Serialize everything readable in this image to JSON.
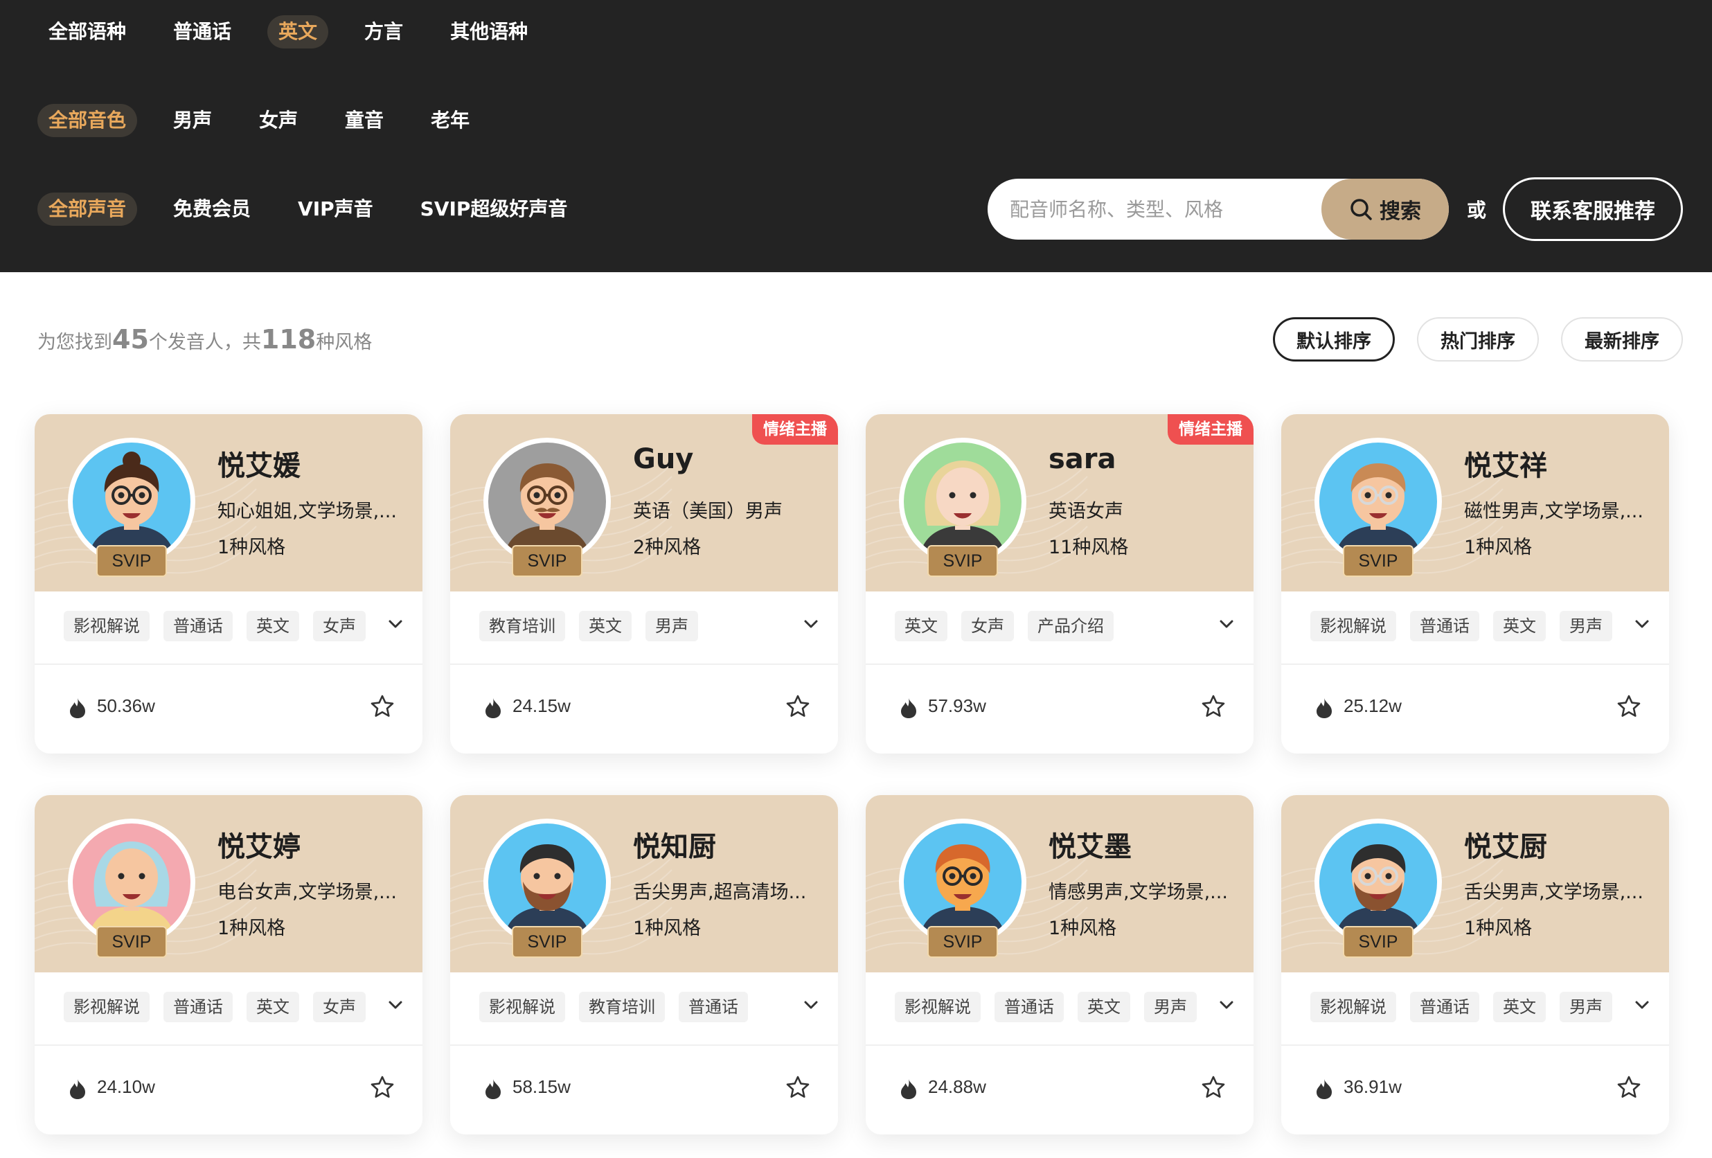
{
  "filters": {
    "language": [
      {
        "label": "全部语种",
        "active": false
      },
      {
        "label": "普通话",
        "active": false
      },
      {
        "label": "英文",
        "active": true
      },
      {
        "label": "方言",
        "active": false
      },
      {
        "label": "其他语种",
        "active": false
      }
    ],
    "timbre": [
      {
        "label": "全部音色",
        "active": true
      },
      {
        "label": "男声",
        "active": false
      },
      {
        "label": "女声",
        "active": false
      },
      {
        "label": "童音",
        "active": false
      },
      {
        "label": "老年",
        "active": false
      }
    ],
    "membership": [
      {
        "label": "全部声音",
        "active": true
      },
      {
        "label": "免费会员",
        "active": false
      },
      {
        "label": "VIP声音",
        "active": false
      },
      {
        "label": "SVIP超级好声音",
        "active": false
      }
    ]
  },
  "search": {
    "placeholder": "配音师名称、类型、风格",
    "value": "",
    "button_label": "搜索",
    "or_text": "或",
    "contact_label": "联系客服推荐"
  },
  "results": {
    "prefix": "为您找到",
    "speakers": "45",
    "middle": "个发音人，共",
    "styles": "118",
    "suffix": "种风格"
  },
  "sort": {
    "options": [
      "默认排序",
      "热门排序",
      "最新排序"
    ],
    "active": "默认排序"
  },
  "colors": {
    "header_bg": "#232323",
    "active_chip_text": "#e8a85c",
    "card_head_bg": "#e7d4bb",
    "search_btn_bg": "#c6ab88",
    "emotion_badge_bg": "#ef5050",
    "svip_badge_bg": "#b48a52"
  },
  "cards": [
    {
      "name": "悦艾媛",
      "desc": "知心姐姐,文学场景,...",
      "styles": "1种风格",
      "badge": "SVIP",
      "emotion": "",
      "tags": [
        "影视解说",
        "普通话",
        "英文",
        "女声"
      ],
      "plays": "50.36w",
      "avatar_icon": "female-glasses-bun-avatar-icon"
    },
    {
      "name": "Guy",
      "desc": "英语（美国）男声",
      "styles": "2种风格",
      "badge": "SVIP",
      "emotion": "情绪主播",
      "tags": [
        "教育培训",
        "英文",
        "男声"
      ],
      "plays": "24.15w",
      "avatar_icon": "male-mustache-avatar-icon"
    },
    {
      "name": "sara",
      "desc": "英语女声",
      "styles": "11种风格",
      "badge": "SVIP",
      "emotion": "情绪主播",
      "tags": [
        "英文",
        "女声",
        "产品介绍"
      ],
      "plays": "57.93w",
      "avatar_icon": "female-blonde-avatar-icon"
    },
    {
      "name": "悦艾祥",
      "desc": "磁性男声,文学场景,...",
      "styles": "1种风格",
      "badge": "SVIP",
      "emotion": "",
      "tags": [
        "影视解说",
        "普通话",
        "英文",
        "男声"
      ],
      "plays": "25.12w",
      "avatar_icon": "male-glasses-avatar-icon"
    },
    {
      "name": "悦艾婷",
      "desc": "电台女声,文学场景,...",
      "styles": "1种风格",
      "badge": "SVIP",
      "emotion": "",
      "tags": [
        "影视解说",
        "普通话",
        "英文",
        "女声"
      ],
      "plays": "24.10w",
      "avatar_icon": "female-pink-hair-avatar-icon"
    },
    {
      "name": "悦知厨",
      "desc": "舌尖男声,超高清场...",
      "styles": "1种风格",
      "badge": "SVIP",
      "emotion": "",
      "tags": [
        "影视解说",
        "教育培训",
        "普通话"
      ],
      "plays": "58.15w",
      "avatar_icon": "male-beard-avatar-icon"
    },
    {
      "name": "悦艾墨",
      "desc": "情感男声,文学场景,...",
      "styles": "1种风格",
      "badge": "SVIP",
      "emotion": "",
      "tags": [
        "影视解说",
        "普通话",
        "英文",
        "男声"
      ],
      "plays": "24.88w",
      "avatar_icon": "male-orange-hair-avatar-icon"
    },
    {
      "name": "悦艾厨",
      "desc": "舌尖男声,文学场景,...",
      "styles": "1种风格",
      "badge": "SVIP",
      "emotion": "",
      "tags": [
        "影视解说",
        "普通话",
        "英文",
        "男声"
      ],
      "plays": "36.91w",
      "avatar_icon": "male-beard-glasses-avatar-icon"
    }
  ]
}
